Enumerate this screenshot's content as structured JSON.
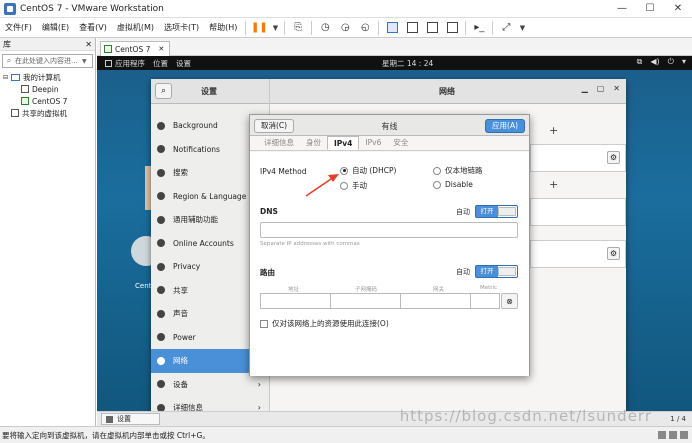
{
  "window": {
    "title": "CentOS 7 - VMware Workstation",
    "minimize": "—",
    "maximize": "☐",
    "close": "✕"
  },
  "menu": {
    "items": [
      "文件(F)",
      "编辑(E)",
      "查看(V)",
      "虚拟机(M)",
      "选项卡(T)",
      "帮助(H)"
    ]
  },
  "library": {
    "title": "库",
    "close": "✕",
    "search_placeholder": "在此处键入内容进...",
    "tree": {
      "root": "我的计算机",
      "vms": [
        "Deepin",
        "CentOS 7"
      ],
      "shared": "共享的虚拟机"
    }
  },
  "tab": {
    "label": "CentOS 7",
    "close": "✕"
  },
  "gnome": {
    "applications": "应用程序",
    "places": "位置",
    "settings_menu": "设置",
    "clock": "星期二 14 : 24"
  },
  "desktop": {
    "label": "CentOS"
  },
  "settings": {
    "title": "设置",
    "panel_title": "网络",
    "sidebar": [
      {
        "label": "Background",
        "active": false,
        "chevron": false
      },
      {
        "label": "Notifications",
        "active": false,
        "chevron": false
      },
      {
        "label": "搜索",
        "active": false,
        "chevron": false
      },
      {
        "label": "Region & Language",
        "active": false,
        "chevron": false
      },
      {
        "label": "通用辅助功能",
        "active": false,
        "chevron": false
      },
      {
        "label": "Online Accounts",
        "active": false,
        "chevron": false
      },
      {
        "label": "Privacy",
        "active": false,
        "chevron": false
      },
      {
        "label": "共享",
        "active": false,
        "chevron": false
      },
      {
        "label": "声音",
        "active": false,
        "chevron": false
      },
      {
        "label": "Power",
        "active": false,
        "chevron": false
      },
      {
        "label": "网络",
        "active": true,
        "chevron": false
      },
      {
        "label": "设备",
        "active": false,
        "chevron": true
      },
      {
        "label": "详细信息",
        "active": false,
        "chevron": true
      }
    ]
  },
  "dialog": {
    "cancel": "取消(C)",
    "title": "有线",
    "apply": "应用(A)",
    "tabs": [
      {
        "label": "详细信息",
        "active": false
      },
      {
        "label": "身份",
        "active": false
      },
      {
        "label": "IPv4",
        "active": true
      },
      {
        "label": "IPv6",
        "active": false
      },
      {
        "label": "安全",
        "active": false
      }
    ],
    "ipv4_method_label": "IPv4 Method",
    "methods": [
      {
        "label": "自动 (DHCP)",
        "checked": true
      },
      {
        "label": "仅本地链路",
        "checked": false
      },
      {
        "label": "手动",
        "checked": false
      },
      {
        "label": "Disable",
        "checked": false
      }
    ],
    "dns": {
      "label": "DNS",
      "auto_label": "自动",
      "toggle": "打开",
      "hint": "Separate IP addresses with commas"
    },
    "routes": {
      "label": "路由",
      "auto_label": "自动",
      "toggle": "打开",
      "columns": [
        "地址",
        "子网掩码",
        "网关",
        "Metric"
      ]
    },
    "checkbox_label": "仅对该网络上的资源使用此连接(O)"
  },
  "taskbar": {
    "item": "设置",
    "page": "1 / 4"
  },
  "statusbar": {
    "text": "要将输入定向到该虚拟机，请在虚拟机内部单击或按 Ctrl+G。"
  },
  "watermark": "https://blog.csdn.net/lsunderr",
  "colors": {
    "accent": "#4a90d9",
    "arrow": "#e0412e"
  }
}
